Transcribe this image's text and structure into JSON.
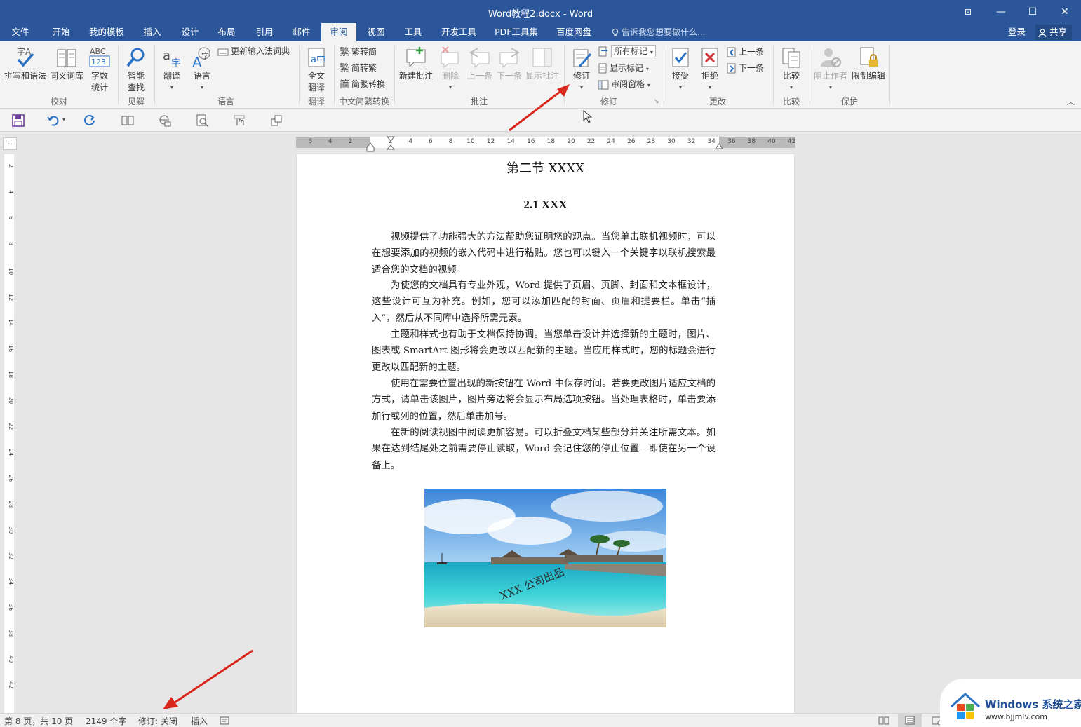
{
  "window": {
    "title": "Word教程2.docx - Word",
    "controls": {
      "ribbon_display": "⊡",
      "minimize": "—",
      "maximize": "☐",
      "close": "✕"
    }
  },
  "tabs": [
    {
      "label": "文件"
    },
    {
      "label": "开始"
    },
    {
      "label": "我的模板"
    },
    {
      "label": "插入"
    },
    {
      "label": "设计"
    },
    {
      "label": "布局"
    },
    {
      "label": "引用"
    },
    {
      "label": "邮件"
    },
    {
      "label": "审阅",
      "active": true
    },
    {
      "label": "视图"
    },
    {
      "label": "工具"
    },
    {
      "label": "开发工具"
    },
    {
      "label": "PDF工具集"
    },
    {
      "label": "百度网盘"
    }
  ],
  "tell_me": "告诉我您想要做什么...",
  "account": {
    "login": "登录",
    "share": "共享"
  },
  "ribbon": {
    "proofing": {
      "spelling": "拼写和语法",
      "thesaurus": "同义词库",
      "wordcount_1": "字数",
      "wordcount_2": "统计",
      "label": "校对"
    },
    "insights": {
      "smart_1": "智能",
      "smart_2": "查找",
      "label": "见解"
    },
    "language": {
      "translate": "翻译",
      "language": "语言",
      "update_ime": "更新输入法词典",
      "label": "语言"
    },
    "translation": {
      "full_1": "全文",
      "full_2": "翻译",
      "label": "翻译"
    },
    "chinese_conv": {
      "to_simplified": "繁转简",
      "to_traditional": "简转繁",
      "convert": "简繁转换",
      "label": "中文简繁转换"
    },
    "comments": {
      "new": "新建批注",
      "delete": "删除",
      "prev": "上一条",
      "next": "下一条",
      "show": "显示批注",
      "label": "批注"
    },
    "tracking": {
      "track": "修订",
      "markup_select": "所有标记",
      "show_markup": "显示标记",
      "review_pane": "审阅窗格",
      "label": "修订"
    },
    "changes": {
      "accept": "接受",
      "reject": "拒绝",
      "prev": "上一条",
      "next": "下一条",
      "label": "更改"
    },
    "compare": {
      "compare": "比较",
      "label": "比较"
    },
    "protect": {
      "block": "阻止作者",
      "restrict": "限制编辑",
      "label": "保护"
    }
  },
  "ruler": {
    "h_numbers": [
      "6",
      "4",
      "2",
      "2",
      "4",
      "6",
      "8",
      "10",
      "12",
      "14",
      "16",
      "18",
      "20",
      "22",
      "24",
      "26",
      "28",
      "30",
      "32",
      "34",
      "36",
      "38",
      "40",
      "42"
    ],
    "v_numbers": [
      "2",
      "4",
      "6",
      "8",
      "10",
      "12",
      "14",
      "16",
      "18",
      "20",
      "22",
      "24",
      "26",
      "28",
      "30",
      "32",
      "34",
      "36",
      "38",
      "40",
      "42"
    ]
  },
  "document": {
    "heading1": "第二节  XXXX",
    "heading2": "2.1 XXX",
    "paragraphs": [
      "视频提供了功能强大的方法帮助您证明您的观点。当您单击联机视频时，可以在想要添加的视频的嵌入代码中进行粘贴。您也可以键入一个关键字以联机搜索最适合您的文档的视频。",
      "为使您的文档具有专业外观，Word 提供了页眉、页脚、封面和文本框设计，这些设计可互为补充。例如，您可以添加匹配的封面、页眉和提要栏。单击“插入”，然后从不同库中选择所需元素。",
      "主题和样式也有助于文档保持协调。当您单击设计并选择新的主题时，图片、图表或 SmartArt 图形将会更改以匹配新的主题。当应用样式时，您的标题会进行更改以匹配新的主题。",
      "使用在需要位置出现的新按钮在 Word 中保存时间。若要更改图片适应文档的方式，请单击该图片，图片旁边将会显示布局选项按钮。当处理表格时，单击要添加行或列的位置，然后单击加号。",
      "在新的阅读视图中阅读更加容易。可以折叠文档某些部分并关注所需文本。如果在达到结尾处之前需要停止读取，Word 会记住您的停止位置 - 即使在另一个设备上。"
    ],
    "image_watermark": "XXX 公司出品"
  },
  "status": {
    "page": "第 8 页，共 10 页",
    "words": "2149 个字",
    "track": "修订: 关闭",
    "insert": "插入"
  },
  "logo": {
    "line1": "Windows 系统之家",
    "line2": "www.bjjmlv.com"
  },
  "colors": {
    "accent": "#2b579a",
    "arrow": "#d9261c"
  }
}
